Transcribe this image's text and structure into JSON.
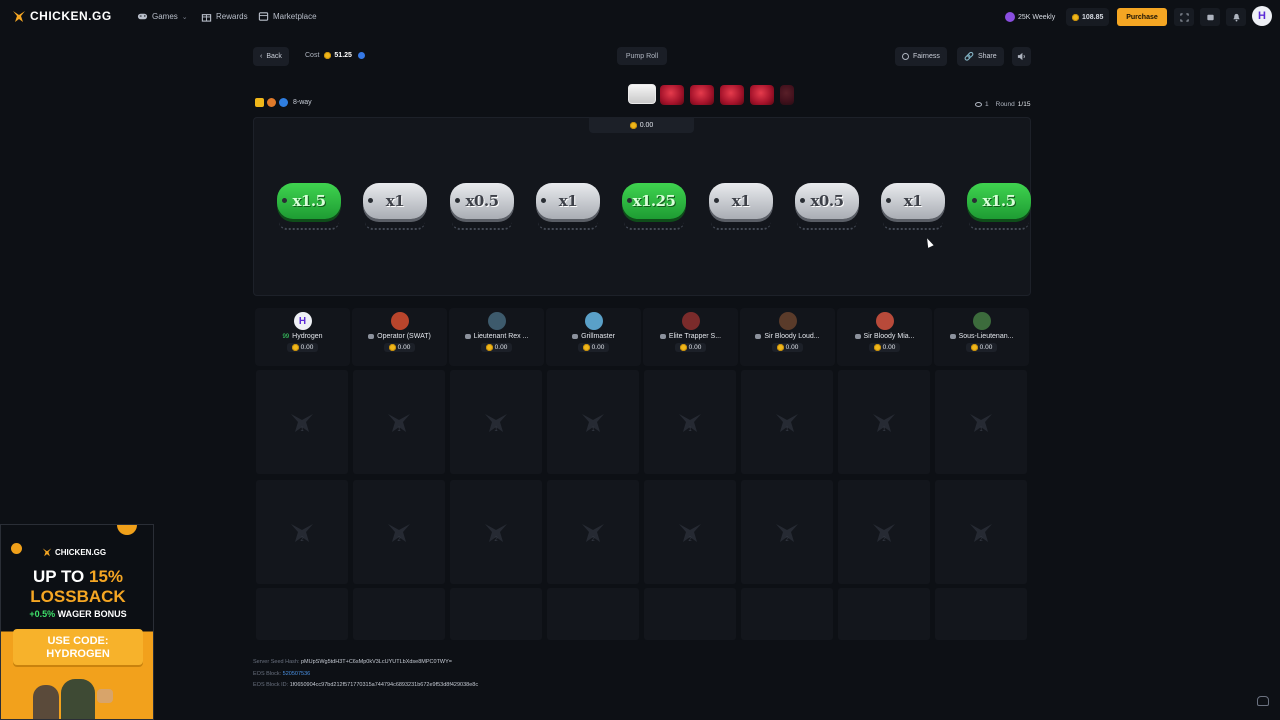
{
  "nav": {
    "brand": "CHICKEN.GG",
    "games": "Games",
    "rewards": "Rewards",
    "marketplace": "Marketplace",
    "weekly": "25K Weekly",
    "balance": "108.85",
    "purchase": "Purchase",
    "user_initial": "H"
  },
  "game": {
    "back": "Back",
    "cost_label": "Cost",
    "cost_value": "51.25",
    "mode": "Pump Roll",
    "fairness": "Fairness",
    "share": "Share",
    "ways": "8-way",
    "viewers": "1",
    "round_label": "Round",
    "round_value": "1/15",
    "total": "0.00"
  },
  "multipliers": [
    "x1.5",
    "x1",
    "x0.5",
    "x1",
    "x1.25",
    "x1",
    "x0.5",
    "x1",
    "x1.5"
  ],
  "multiplier_colors": [
    "green",
    "grey",
    "grey",
    "grey",
    "green",
    "grey",
    "grey",
    "grey",
    "green"
  ],
  "players": [
    {
      "name": "Hydrogen",
      "level": "99",
      "amount": "0.00",
      "avatar": "H"
    },
    {
      "name": "Operator (SWAT)",
      "amount": "0.00"
    },
    {
      "name": "Lieutenant Rex ...",
      "amount": "0.00"
    },
    {
      "name": "Grillmaster",
      "amount": "0.00"
    },
    {
      "name": "Elite Trapper S...",
      "amount": "0.00"
    },
    {
      "name": "Sir Bloody Loud...",
      "amount": "0.00"
    },
    {
      "name": "Sir Bloody Mia...",
      "amount": "0.00"
    },
    {
      "name": "Sous-Lieutenan...",
      "amount": "0.00"
    }
  ],
  "rows": [
    "1",
    "2"
  ],
  "footer": {
    "server_hash_label": "Server Seed Hash:",
    "server_hash": "pMUpSWg5tdH3T+C6sMp0kV3LcUYUTLbXdse8MPC0TWY=",
    "eos_block_label": "EOS Block:",
    "eos_block": "520507536",
    "eos_block_id_label": "EOS Block ID:",
    "eos_block_id": "1f0650904cc97bd212f571770315a744794c6893231b672e9f53d8f429038e8c"
  },
  "promo": {
    "brand": "CHICKEN.GG",
    "line1a": "UP TO ",
    "line1b": "15%",
    "line2": "LOSSBACK",
    "bonus_a": "+0.5%",
    "bonus_b": " WAGER BONUS",
    "code_line1": "USE CODE:",
    "code_line2": "HYDROGEN"
  },
  "colors": {
    "accent": "#f5a623",
    "green": "#2fbf45",
    "background": "#0d1015"
  }
}
